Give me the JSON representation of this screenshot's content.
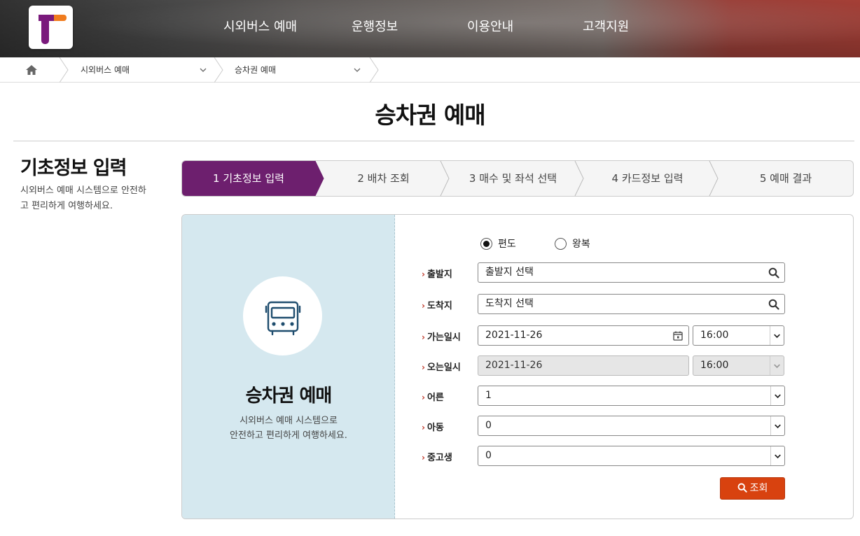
{
  "header": {
    "nav": [
      "시외버스 예매",
      "운행정보",
      "이용안내",
      "고객지원"
    ],
    "colors": {
      "brand_purple": "#6d1f6e",
      "brand_orange": "#f07c1e",
      "search_button": "#d8420f"
    }
  },
  "breadcrumb": {
    "home_icon": "home-icon",
    "items": [
      "시외버스 예매",
      "승차권 예매"
    ]
  },
  "page": {
    "title": "승차권 예매"
  },
  "side": {
    "title": "기초정보 입력",
    "desc_line1": "시외버스 예매 시스템으로 안전하",
    "desc_line2": "고 편리하게 여행하세요."
  },
  "steps": [
    {
      "label": "1 기초정보 입력",
      "active": true
    },
    {
      "label": "2 배차 조회",
      "active": false
    },
    {
      "label": "3 매수 및 좌석 선택",
      "active": false
    },
    {
      "label": "4 카드정보 입력",
      "active": false
    },
    {
      "label": "5 예매 결과",
      "active": false
    }
  ],
  "panel": {
    "icon": "bus-icon",
    "title": "승차권 예매",
    "desc_line1": "시외버스 예매 시스템으로",
    "desc_line2": "안전하고 편리하게 여행하세요."
  },
  "form": {
    "trip_type": {
      "options": [
        "편도",
        "왕복"
      ],
      "selected": "편도"
    },
    "departure": {
      "label": "출발지",
      "value": "출발지 선택"
    },
    "arrival": {
      "label": "도착지",
      "value": "도착지 선택"
    },
    "go_datetime": {
      "label": "가는일시",
      "date": "2021-11-26",
      "time": "16:00"
    },
    "return_datetime": {
      "label": "오는일시",
      "date": "2021-11-26",
      "time": "16:00"
    },
    "adult": {
      "label": "어른",
      "value": "1"
    },
    "child": {
      "label": "아동",
      "value": "0"
    },
    "student": {
      "label": "중고생",
      "value": "0"
    },
    "search_button": "조회"
  }
}
